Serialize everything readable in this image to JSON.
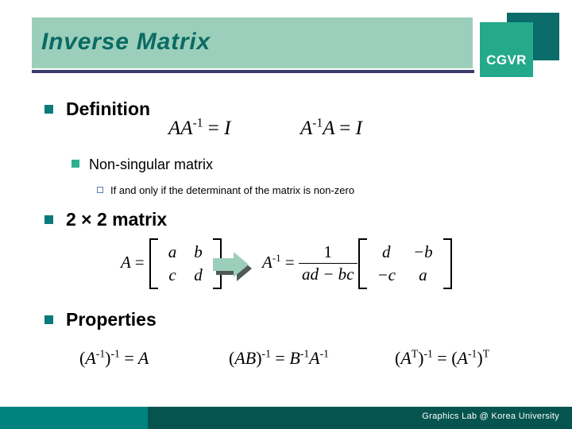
{
  "header": {
    "title": "Inverse Matrix",
    "band_color": "#9ccfbb",
    "title_color": "#0a6b63",
    "rule_color": "#3b3b6b"
  },
  "logo": {
    "text": "CGVR",
    "back_color": "#0c6b6b",
    "front_color": "#24a98a",
    "text_color": "#ffffff"
  },
  "bullets": {
    "definition": "Definition",
    "non_singular": "Non-singular matrix",
    "non_singular_detail": "If and only if the determinant of the matrix is non-zero",
    "two_by_two": "2 × 2 matrix",
    "properties": "Properties"
  },
  "equations": {
    "def_left": {
      "lhs_a": "A",
      "lhs_a_inv": "A",
      "inv_exp": "-1",
      "eq": "=",
      "rhs": "I"
    },
    "def_right": {
      "a_inv": "A",
      "inv_exp": "-1",
      "a": "A",
      "eq": "=",
      "rhs": "I"
    },
    "matrix_a": {
      "label": "A",
      "eq": "=",
      "cells": [
        [
          "a",
          "b"
        ],
        [
          "c",
          "d"
        ]
      ]
    },
    "matrix_a_inv": {
      "label": "A",
      "inv_exp": "-1",
      "eq": "=",
      "numerator": "1",
      "denominator": "ad − bc",
      "cells": [
        [
          "d",
          "−b"
        ],
        [
          "−c",
          "a"
        ]
      ]
    },
    "property_1": {
      "open": "(",
      "base": "A",
      "inner_exp": "-1",
      "close": ")",
      "outer_exp": "-1",
      "eq": "=",
      "rhs": "A"
    },
    "property_2": {
      "open": "(",
      "base": "AB",
      "close": ")",
      "exp": "-1",
      "eq": "=",
      "rhs_b": "B",
      "rhs_b_exp": "-1",
      "rhs_a": "A",
      "rhs_a_exp": "-1"
    },
    "property_3": {
      "open": "(",
      "base": "A",
      "t_exp": "T",
      "close": ")",
      "exp": "-1",
      "eq": "=",
      "rhs_open": "(",
      "rhs_base": "A",
      "rhs_inner_exp": "-1",
      "rhs_close": ")",
      "rhs_t_exp": "T"
    }
  },
  "arrow": {
    "fill_color": "#9ccfbb",
    "shadow_color": "#4f5a58"
  },
  "footer": {
    "text": "Graphics Lab @ Korea University",
    "left_color": "#00827f",
    "right_color": "#055450"
  }
}
